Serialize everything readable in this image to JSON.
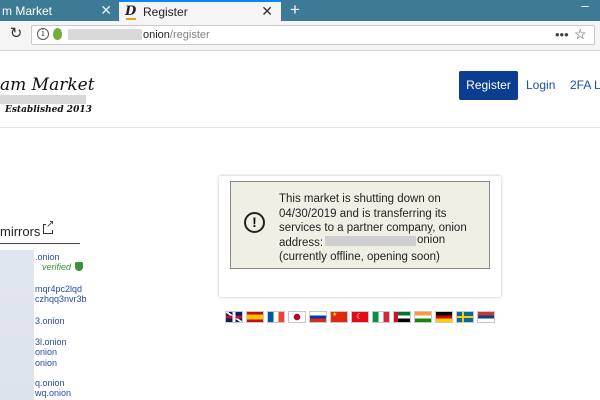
{
  "tabs": [
    {
      "label": "m Market",
      "active": false
    },
    {
      "label": "Register",
      "active": true
    }
  ],
  "toolbar": {
    "url_domain": "onion",
    "url_path": "/register"
  },
  "site": {
    "logo": "am Market",
    "tagline": "Established 2013"
  },
  "nav": {
    "register": "Register",
    "login": "Login",
    "twofa": "2FA L"
  },
  "mirrors": {
    "title": "mirrors",
    "verified": "verified",
    "items": [
      ".onion",
      "mqr4pc2lqd",
      "czhqq3nvr3b",
      "3.onion",
      "3l.onion",
      "onion",
      "onion",
      "q.onion",
      "wq.onion"
    ]
  },
  "notice": {
    "line1": "This market is shutting down on",
    "line2": "04/30/2019 and is transferring its",
    "line3": "services to a partner company, onion",
    "line4a": "address:",
    "line4b": "onion",
    "line5": "(currently offline, opening soon)"
  },
  "flags": [
    "uk-flag",
    "spain-flag",
    "france-flag",
    "japan-flag",
    "russia-flag",
    "china-flag",
    "turkey-flag",
    "italy-flag",
    "uae-flag",
    "india-flag",
    "germany-flag",
    "sweden-flag",
    "serbia-flag"
  ],
  "colors": {
    "tabstrip": "#3d7a96",
    "register_button": "#0b3d91",
    "link": "#1a4fa0",
    "verified": "#3c8f3c"
  }
}
